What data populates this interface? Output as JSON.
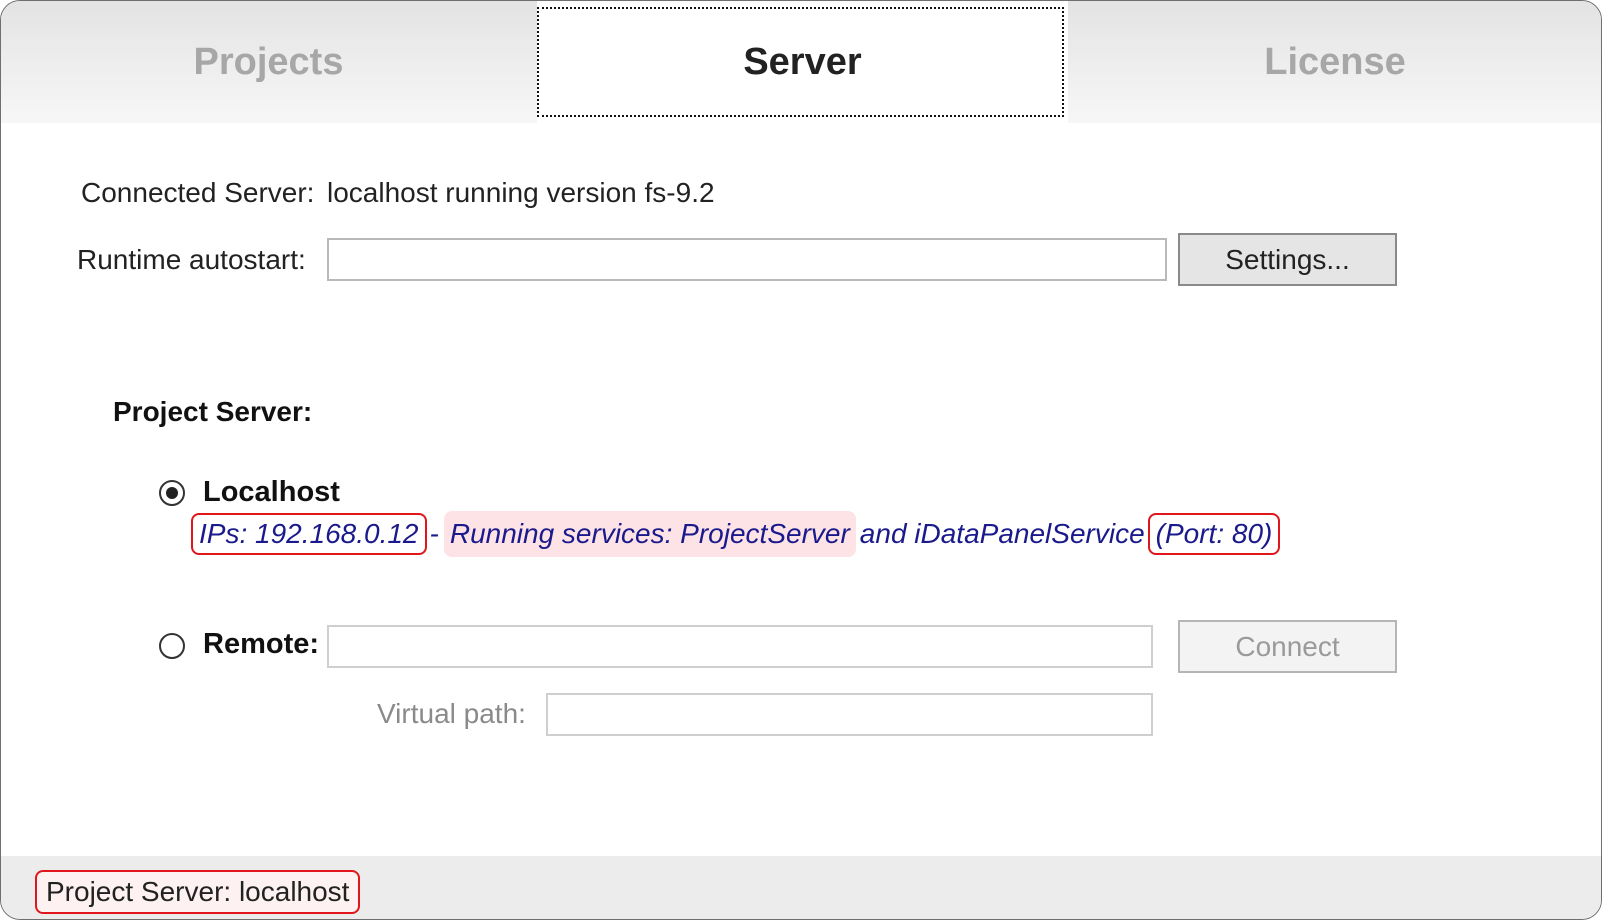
{
  "tabs": [
    {
      "label": "Projects",
      "selected": false
    },
    {
      "label": "Server",
      "selected": true
    },
    {
      "label": "License",
      "selected": false
    }
  ],
  "connected_server": {
    "label": "Connected Server:",
    "value": "localhost running version fs-9.2"
  },
  "runtime_autostart": {
    "label": "Runtime autostart:",
    "value": "",
    "settings_button": "Settings..."
  },
  "project_server": {
    "title": "Project Server:",
    "localhost": {
      "label": "Localhost",
      "checked": true,
      "ips": "IPs: 192.168.0.12",
      "separator": "-",
      "services": "Running services: ProjectServer",
      "services_tail": "and iDataPanelService",
      "port": "(Port: 80)"
    },
    "remote": {
      "label": "Remote:",
      "checked": false,
      "value": "",
      "connect_button": "Connect",
      "virtual_path_label": "Virtual path:",
      "virtual_path_value": ""
    }
  },
  "status_bar": {
    "text": "Project Server: localhost"
  },
  "colors": {
    "highlight_border": "#e0161c",
    "highlight_fill": "#fde3e5",
    "info_text": "#1a1a8c"
  }
}
